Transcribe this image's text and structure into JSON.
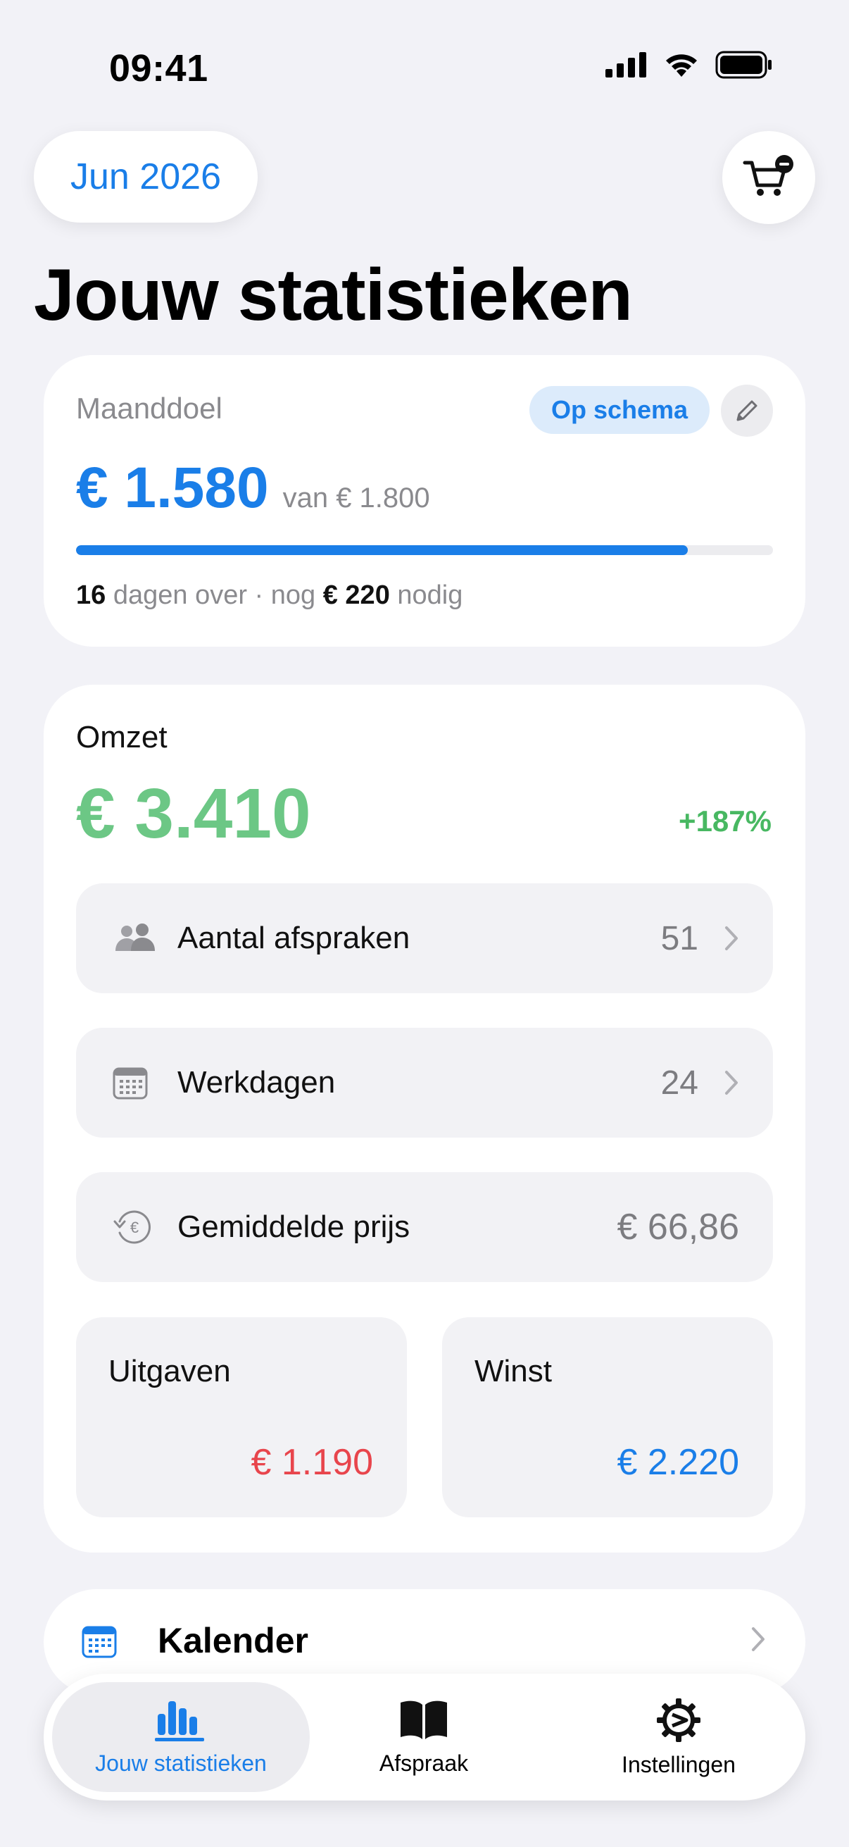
{
  "status_bar": {
    "time": "09:41"
  },
  "header": {
    "month": "Jun 2026",
    "title": "Jouw statistieken"
  },
  "goal": {
    "label": "Maanddoel",
    "status": "Op schema",
    "amount": "€ 1.580",
    "target": "van € 1.800",
    "progress_fraction": 0.878,
    "footer_days": "16",
    "footer_text1": "dagen over · nog",
    "footer_amount": "€ 220",
    "footer_text2": "nodig"
  },
  "revenue": {
    "label": "Omzet",
    "amount": "€ 3.410",
    "change": "+187%",
    "stats": [
      {
        "label": "Aantal afspraken",
        "value": "51",
        "icon": "people-icon"
      },
      {
        "label": "Werkdagen",
        "value": "24",
        "icon": "calendar-icon"
      },
      {
        "label": "Gemiddelde prijs",
        "value": "€ 66,86",
        "icon": "euro-history-icon"
      }
    ],
    "expenses": {
      "label": "Uitgaven",
      "value": "€ 1.190"
    },
    "profit": {
      "label": "Winst",
      "value": "€ 2.220"
    }
  },
  "calendar": {
    "label": "Kalender"
  },
  "tabs": [
    {
      "label": "Jouw statistieken",
      "icon": "chart-bar-icon",
      "active": true
    },
    {
      "label": "Afspraak",
      "icon": "book-icon",
      "active": false
    },
    {
      "label": "Instellingen",
      "icon": "gear-icon",
      "active": false
    }
  ],
  "colors": {
    "accent_blue": "#1a7ee8",
    "revenue_green": "#6cc785",
    "change_green": "#48b862",
    "expense_red": "#e8454c"
  }
}
